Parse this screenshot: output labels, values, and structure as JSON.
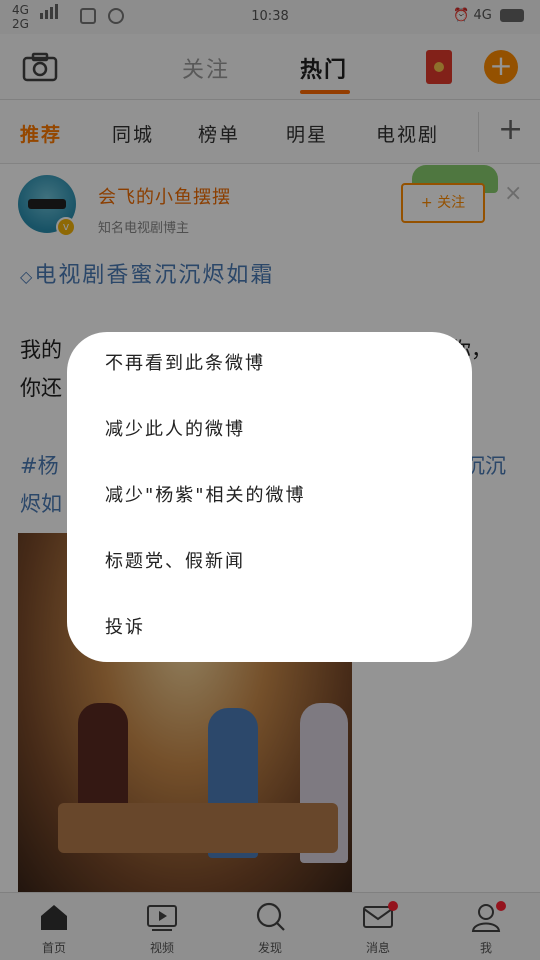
{
  "status_bar": {
    "network_top": "4G",
    "network_bottom": "2G",
    "time": "10:38",
    "network_right": "4G"
  },
  "header": {
    "tab_follow": "关注",
    "tab_hot": "热门",
    "plus_symbol": "+"
  },
  "channels": {
    "items": [
      "推荐",
      "同城",
      "榜单",
      "明星",
      "电视剧"
    ],
    "add_symbol": "+"
  },
  "post": {
    "user_name": "会飞的小鱼摆摆",
    "user_title": "知名电视剧博主",
    "follow_label": "+ 关注",
    "close_symbol": "×",
    "verified_symbol": "v",
    "topic": "电视剧香蜜沉沉烬如霜",
    "body_text": "我的",
    "body_text_line2": "你还",
    "body_text_right": "你，",
    "hashtag_left": "#杨",
    "hashtag_left_line2": "烬如",
    "hashtag_right": "沉沉"
  },
  "menu": {
    "items": [
      "不再看到此条微博",
      "减少此人的微博",
      "减少\"杨紫\"相关的微博",
      "标题党、假新闻",
      "投诉"
    ]
  },
  "bottom_nav": {
    "items": [
      {
        "label": "首页",
        "icon": "home-icon"
      },
      {
        "label": "视频",
        "icon": "video-icon"
      },
      {
        "label": "发现",
        "icon": "search-icon"
      },
      {
        "label": "消息",
        "icon": "mail-icon"
      },
      {
        "label": "我",
        "icon": "profile-icon"
      }
    ]
  },
  "colors": {
    "accent": "#ff8c00",
    "active_channel": "#ff7a00",
    "topic_link": "#4a7ab5",
    "badge_red": "#ff2233"
  }
}
